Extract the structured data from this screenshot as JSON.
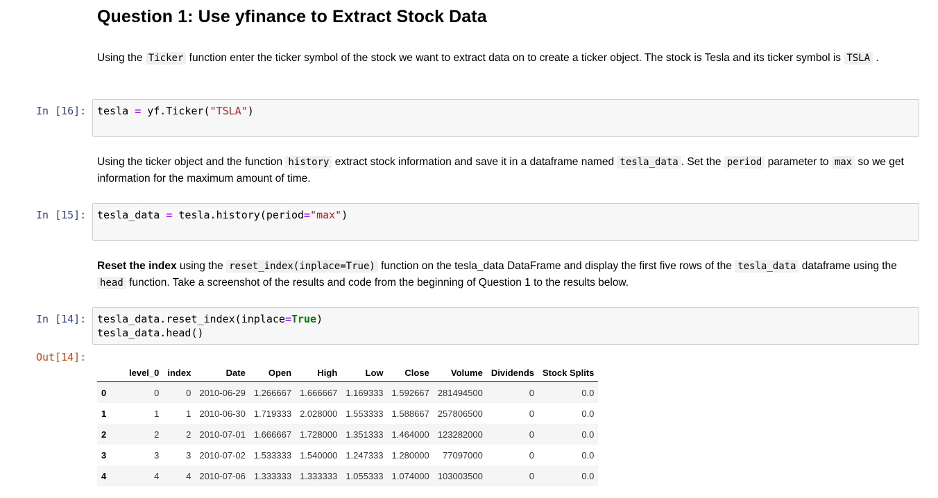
{
  "heading": "Question 1: Use yfinance to Extract Stock Data",
  "md1": {
    "t1": "Using the ",
    "c1": "Ticker",
    "t2": " function enter the ticker symbol of the stock we want to extract data on to create a ticker object. The stock is Tesla and its ticker symbol is ",
    "c2": "TSLA",
    "t3": " ."
  },
  "cell1": {
    "prompt": "In [16]:",
    "code": {
      "a": "tesla ",
      "op": "=",
      "b": " yf.Ticker(",
      "str": "\"TSLA\"",
      "c": ")"
    }
  },
  "md2": {
    "t1": "Using the ticker object and the function ",
    "c1": "history",
    "t2": " extract stock information and save it in a dataframe named ",
    "c2": "tesla_data",
    "t3": ". Set the ",
    "c3": "period",
    "t4": " parameter to ",
    "c4": "max",
    "t5": " so we get information for the maximum amount of time."
  },
  "cell2": {
    "prompt": "In [15]:",
    "code": {
      "a": "tesla_data ",
      "op": "=",
      "b": " tesla.history(period",
      "op2": "=",
      "str": "\"max\"",
      "c": ")"
    }
  },
  "md3": {
    "bold": "Reset the index",
    "t1": " using the ",
    "c1": "reset_index(inplace=True)",
    "t2": " function on the tesla_data DataFrame and display the first five rows of the ",
    "c2": "tesla_data",
    "t3": " dataframe using the ",
    "c3": "head",
    "t4": " function. Take a screenshot of the results and code from the beginning of Question 1 to the results below."
  },
  "cell3": {
    "prompt": "In [14]:",
    "line1": {
      "a": "tesla_data.reset_index(inplace",
      "op": "=",
      "kw": "True",
      "b": ")"
    },
    "line2": "tesla_data.head()"
  },
  "out": {
    "prompt": "Out[14]:",
    "columns": [
      "",
      "level_0",
      "index",
      "Date",
      "Open",
      "High",
      "Low",
      "Close",
      "Volume",
      "Dividends",
      "Stock Splits"
    ],
    "rows": [
      [
        "0",
        "0",
        "0",
        "2010-06-29",
        "1.266667",
        "1.666667",
        "1.169333",
        "1.592667",
        "281494500",
        "0",
        "0.0"
      ],
      [
        "1",
        "1",
        "1",
        "2010-06-30",
        "1.719333",
        "2.028000",
        "1.553333",
        "1.588667",
        "257806500",
        "0",
        "0.0"
      ],
      [
        "2",
        "2",
        "2",
        "2010-07-01",
        "1.666667",
        "1.728000",
        "1.351333",
        "1.464000",
        "123282000",
        "0",
        "0.0"
      ],
      [
        "3",
        "3",
        "3",
        "2010-07-02",
        "1.533333",
        "1.540000",
        "1.247333",
        "1.280000",
        "77097000",
        "0",
        "0.0"
      ],
      [
        "4",
        "4",
        "4",
        "2010-07-06",
        "1.333333",
        "1.333333",
        "1.055333",
        "1.074000",
        "103003500",
        "0",
        "0.0"
      ]
    ]
  }
}
